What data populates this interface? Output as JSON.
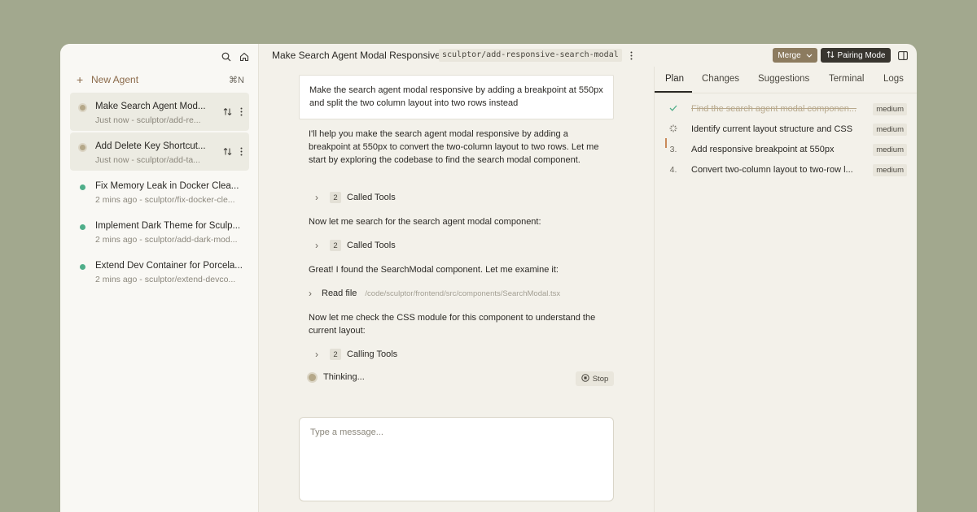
{
  "sidebar": {
    "new_agent_label": "New Agent",
    "new_agent_shortcut": "⌘N",
    "agents": [
      {
        "title": "Make Search Agent Mod...",
        "subtitle": "Just now - sculptor/add-re...",
        "status": "running"
      },
      {
        "title": "Add Delete Key Shortcut...",
        "subtitle": "Just now - sculptor/add-ta...",
        "status": "running"
      },
      {
        "title": "Fix Memory Leak in Docker Clea...",
        "subtitle": "2 mins ago - sculptor/fix-docker-cle...",
        "status": "done"
      },
      {
        "title": "Implement Dark Theme for Sculp...",
        "subtitle": "2 mins ago - sculptor/add-dark-mod...",
        "status": "done"
      },
      {
        "title": "Extend Dev Container for Porcela...",
        "subtitle": "2 mins ago - sculptor/extend-devco...",
        "status": "done"
      }
    ]
  },
  "header": {
    "title": "Make Search Agent Modal Responsive",
    "branch": "sculptor/add-responsive-search-modal",
    "merge_label": "Merge",
    "pairing_label": "Pairing Mode"
  },
  "chat": {
    "user_message": "Make the search agent modal responsive by adding a breakpoint at 550px and split the two column layout into two rows instead",
    "assistant_intro": "I'll help you make the search agent modal responsive by adding a breakpoint at 550px to convert the two-column layout to two rows. Let me start by exploring the codebase to find the search modal component.",
    "tool_group_1": {
      "count": "2",
      "label": "Called Tools"
    },
    "msg_2": "Now let me search for the search agent modal component:",
    "tool_group_2": {
      "count": "2",
      "label": "Called Tools"
    },
    "msg_3": "Great! I found the SearchModal component. Let me examine it:",
    "read_file": {
      "label": "Read file",
      "path": "/code/sculptor/frontend/src/components/SearchModal.tsx"
    },
    "msg_4": "Now let me check the CSS module for this component to understand the current layout:",
    "tool_group_3": {
      "count": "2",
      "label": "Calling Tools"
    },
    "thinking_label": "Thinking...",
    "stop_label": "Stop",
    "input_placeholder": "Type a message..."
  },
  "right_panel": {
    "tabs": [
      "Plan",
      "Changes",
      "Suggestions",
      "Terminal",
      "Logs"
    ],
    "active_tab": "Plan",
    "plan": [
      {
        "marker": "✓",
        "label": "Find the search agent modal componen...",
        "priority": "medium",
        "state": "done"
      },
      {
        "marker": "",
        "label": "Identify current layout structure and CSS",
        "priority": "medium",
        "state": "in-progress"
      },
      {
        "marker": "3.",
        "label": "Add responsive breakpoint at 550px",
        "priority": "medium",
        "state": "todo"
      },
      {
        "marker": "4.",
        "label": "Convert two-column layout to two-row l...",
        "priority": "medium",
        "state": "todo"
      }
    ]
  },
  "colors": {
    "accent_brown": "#8c7b5f",
    "dark_button": "#38352f",
    "status_green": "#4fae89",
    "status_running": "#b5a889"
  }
}
